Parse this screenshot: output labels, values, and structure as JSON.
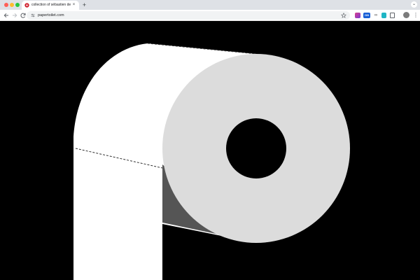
{
  "browser": {
    "tab": {
      "title": "collection of sébastien de ganay",
      "close_glyph": "×",
      "favicon": "toilet-paper-icon"
    },
    "new_tab_glyph": "+",
    "tab_menu_glyph": "⌄",
    "url": "papertoilet.com",
    "extensions": {
      "badge_text": "ON",
      "glyph": "∞"
    },
    "menu_glyph": "⋮"
  },
  "colors": {
    "background": "#000000",
    "roll_face": "#dcdcdc",
    "roll_body": "#ffffff",
    "shadow": "#555555",
    "perforation": "#333333"
  },
  "page": {
    "content": "paper-toilet-roll-illustration"
  }
}
